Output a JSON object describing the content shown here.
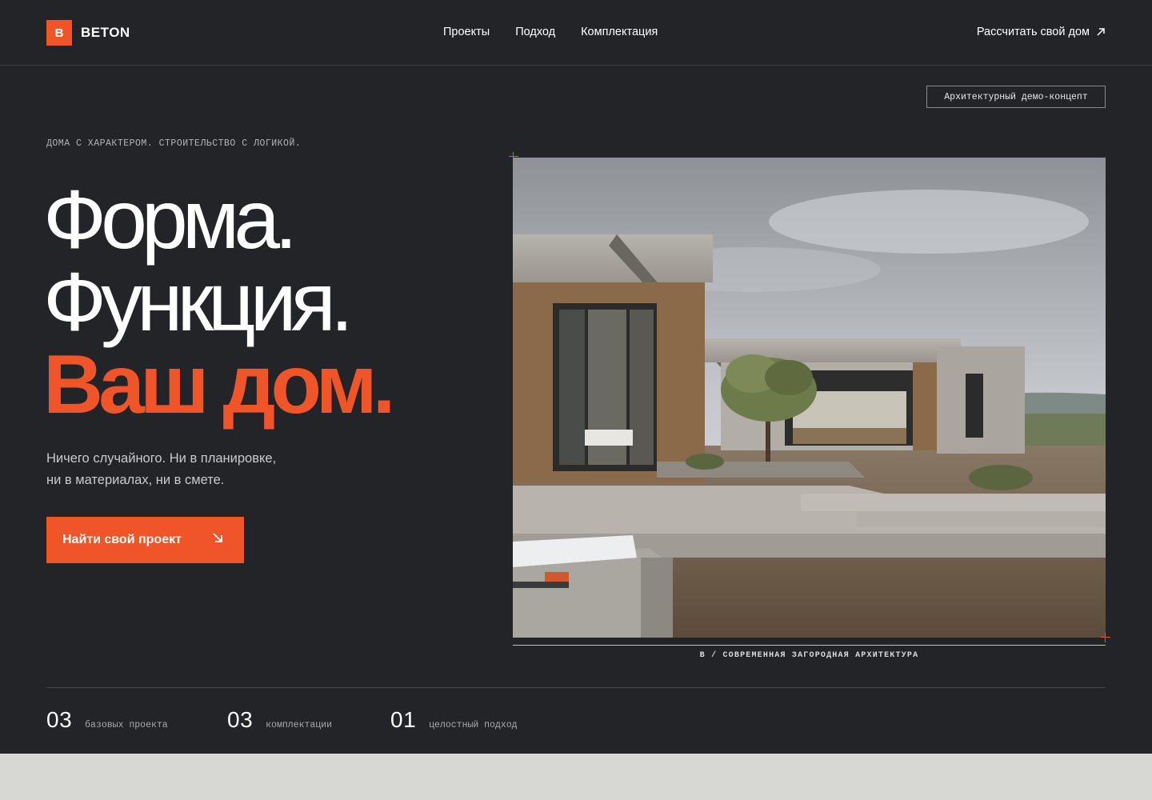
{
  "header": {
    "logo_mark": "B",
    "logo_text": "BETON",
    "nav": [
      "Проекты",
      "Подход",
      "Комплектация"
    ],
    "cta": "Рассчитать свой дом",
    "cta_icon": "arrow-up-right-icon"
  },
  "badge": "Архитектурный демо-концепт",
  "hero": {
    "eyebrow": "ДОМА С ХАРАКТЕРОМ. СТРОИТЕЛЬСТВО С ЛОГИКОЙ.",
    "line1": "Форма.",
    "line2": "Функция.",
    "line3": "Ваш дом.",
    "sub1": "Ничего случайного. Ни в планировке,",
    "sub2": "ни в материалах, ни в смете.",
    "button": "Найти свой проект",
    "button_icon": "arrow-down-right-icon"
  },
  "photo": {
    "caption": "B / СОВРЕМЕННАЯ ЗАГОРОДНАЯ АРХИТЕКТУРА"
  },
  "stats": [
    {
      "num": "03",
      "label": "базовых проекта"
    },
    {
      "num": "03",
      "label": "комплектации"
    },
    {
      "num": "01",
      "label": "целостный подход"
    }
  ],
  "colors": {
    "background": "#232428",
    "accent": "#f0552a",
    "footer_band": "#d7d7d3"
  }
}
